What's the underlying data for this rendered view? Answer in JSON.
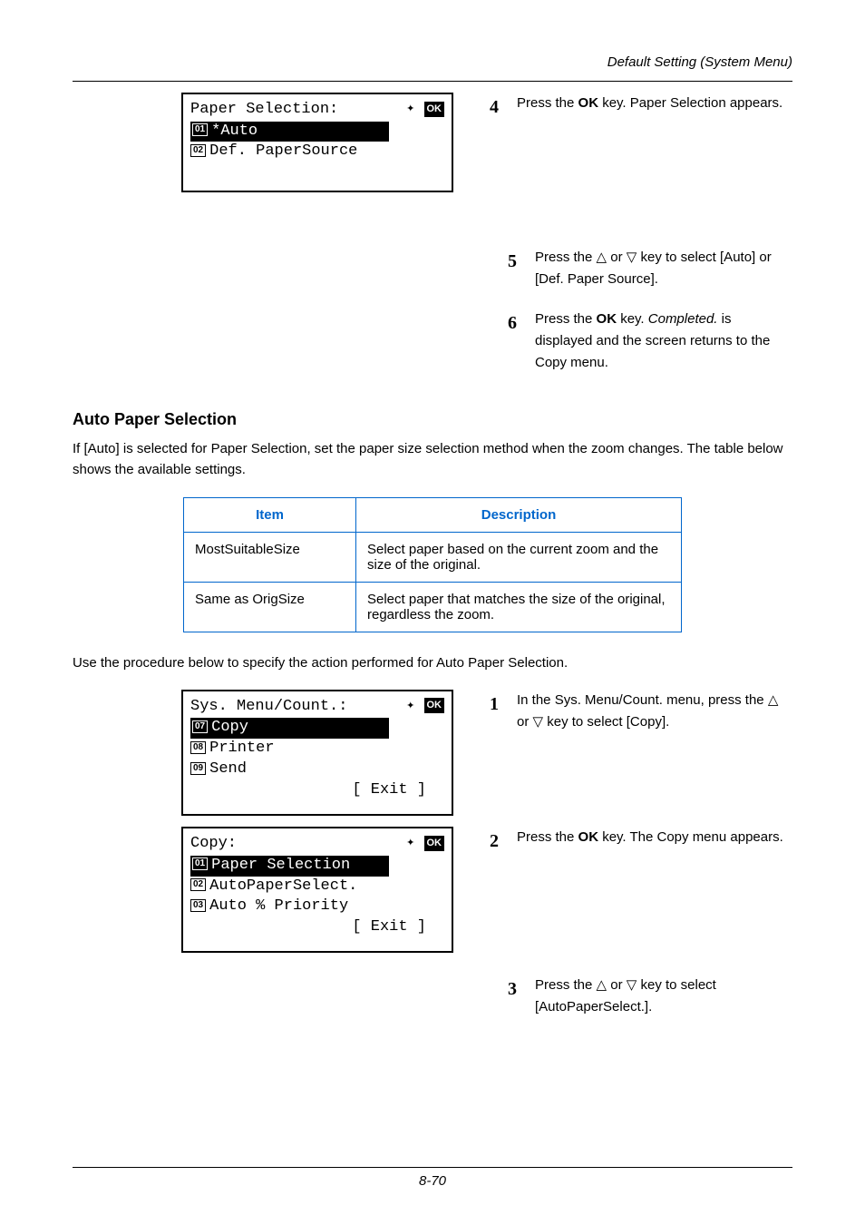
{
  "header": {
    "runhead": "Default Setting (System Menu)"
  },
  "lcd1": {
    "title": "Paper Selection:",
    "row1_num": "01",
    "row1_text": "*Auto",
    "row2_num": "02",
    "row2_text": "Def. PaperSource"
  },
  "steps_a": {
    "s4_num": "4",
    "s4_text_before": "Press the ",
    "s4_key": "OK",
    "s4_text_after": " key. Paper Selection appears.",
    "s5_num": "5",
    "s5_text_before": "Press the ",
    "s5_tri_up": "△",
    "s5_or": " or ",
    "s5_tri_dn": "▽",
    "s5_text_after": " key to select [Auto] or [Def. Paper Source].",
    "s6_num": "6",
    "s6_text_before": "Press the ",
    "s6_key": "OK",
    "s6_text_mid": " key. ",
    "s6_italic": "Completed.",
    "s6_text_after": " is displayed and the screen returns to the Copy menu."
  },
  "section2": {
    "title": "Auto Paper Selection",
    "para": "If [Auto] is selected for Paper Selection, set the paper size selection method when the zoom changes. The table below shows the available settings."
  },
  "table": {
    "h1": "Item",
    "h2": "Description",
    "r1c1": "MostSuitableSize",
    "r1c2": "Select paper based on the current zoom and the size of the original.",
    "r2c1": "Same as OrigSize",
    "r2c2": "Select paper that matches the size of the original, regardless the zoom."
  },
  "para2": "Use the procedure below to specify the action performed for Auto Paper Selection.",
  "lcd2": {
    "title": "Sys. Menu/Count.:",
    "row1_num": "07",
    "row1_text": "Copy",
    "row2_num": "08",
    "row2_text": "Printer",
    "row3_num": "09",
    "row3_text": "Send",
    "exit": "[  Exit  ]"
  },
  "lcd3": {
    "title": "Copy:",
    "row1_num": "01",
    "row1_text": "Paper Selection",
    "row2_num": "02",
    "row2_text": "AutoPaperSelect.",
    "row3_num": "03",
    "row3_text": "Auto % Priority",
    "exit": "[  Exit  ]"
  },
  "steps_b": {
    "s1_num": "1",
    "s1_text_before": "In the Sys. Menu/Count. menu, press the ",
    "s1_tri_up": "△",
    "s1_or": " or ",
    "s1_tri_dn": "▽",
    "s1_text_after": " key to select [Copy].",
    "s2_num": "2",
    "s2_text_before": "Press the ",
    "s2_key": "OK",
    "s2_text_after": " key. The Copy menu appears.",
    "s3_num": "3",
    "s3_text_before": "Press the ",
    "s3_tri_up": "△",
    "s3_or": " or ",
    "s3_tri_dn": "▽",
    "s3_text_after": " key to select [AutoPaperSelect.]."
  },
  "footer": {
    "pageno": "8-70"
  }
}
